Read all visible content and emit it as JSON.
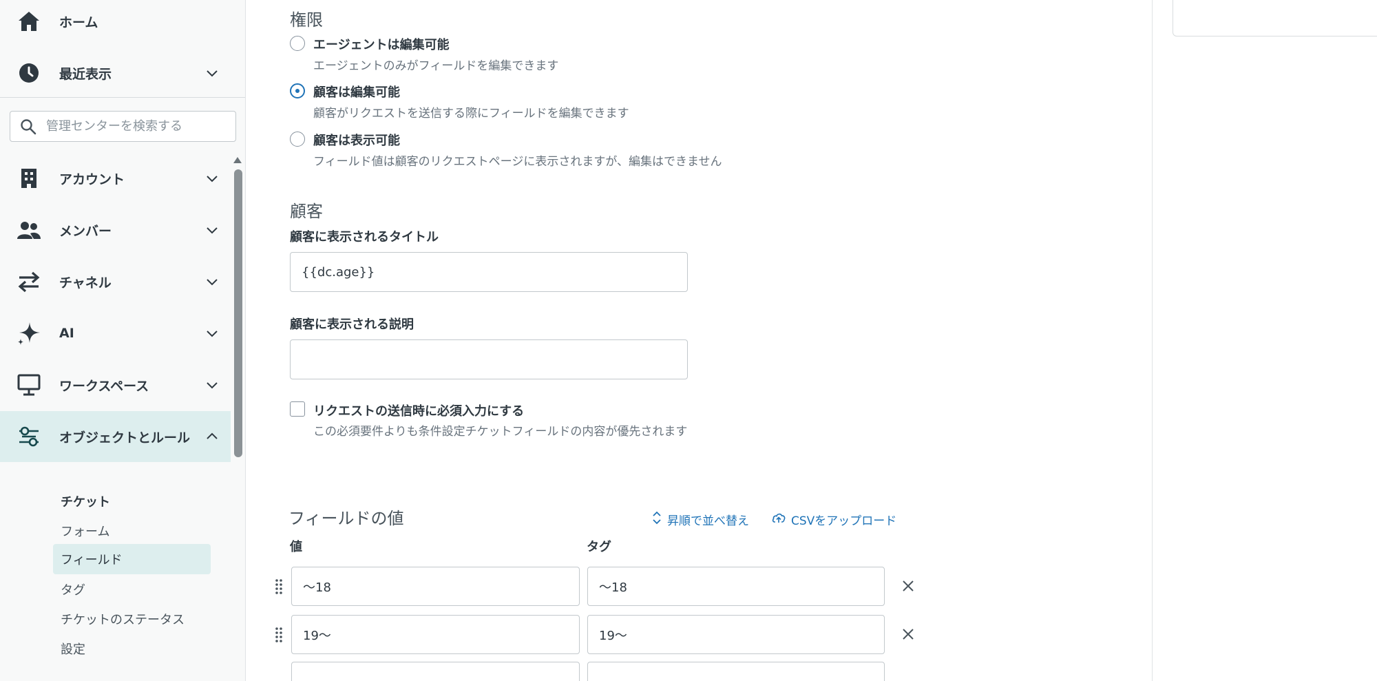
{
  "sidebar": {
    "top_items": [
      {
        "label": "ホーム",
        "icon": "home-icon"
      },
      {
        "label": "最近表示",
        "icon": "clock-icon"
      }
    ],
    "search": {
      "placeholder": "管理センターを検索する"
    },
    "items": [
      {
        "label": "アカウント",
        "icon": "building-icon"
      },
      {
        "label": "メンバー",
        "icon": "people-icon"
      },
      {
        "label": "チャネル",
        "icon": "arrows-icon"
      },
      {
        "label": "AI",
        "icon": "sparkle-icon"
      },
      {
        "label": "ワークスペース",
        "icon": "monitor-icon"
      },
      {
        "label": "オブジェクトとルール",
        "icon": "objects-rules-icon",
        "active": true
      }
    ],
    "sub_menu": {
      "header": "チケット",
      "items": [
        "フォーム",
        "フィールド",
        "タグ",
        "チケットのステータス",
        "設定"
      ],
      "selected": "フィールド"
    }
  },
  "permissions": {
    "title": "権限",
    "options": [
      {
        "label": "エージェントは編集可能",
        "hint": "エージェントのみがフィールドを編集できます",
        "checked": false
      },
      {
        "label": "顧客は編集可能",
        "hint": "顧客がリクエストを送信する際にフィールドを編集できます",
        "checked": true
      },
      {
        "label": "顧客は表示可能",
        "hint": "フィールド値は顧客のリクエストページに表示されますが、編集はできません",
        "checked": false
      }
    ]
  },
  "customer": {
    "title": "顧客",
    "title_field": {
      "label": "顧客に表示されるタイトル",
      "value": "{{dc.age}}"
    },
    "description_field": {
      "label": "顧客に表示される説明",
      "value": ""
    },
    "required": {
      "label": "リクエストの送信時に必須入力にする",
      "hint": "この必須要件よりも条件設定チケットフィールドの内容が優先されます",
      "checked": false
    }
  },
  "field_values": {
    "title": "フィールドの値",
    "sort_label": "昇順で並べ替え",
    "upload_label": "CSVをアップロード",
    "value_header": "値",
    "tag_header": "タグ",
    "rows": [
      {
        "value": "〜18",
        "tag": "〜18"
      },
      {
        "value": "19〜",
        "tag": "19〜"
      },
      {
        "value": "",
        "tag": ""
      }
    ]
  },
  "colors": {
    "accent": "#1f73b7",
    "active_bg": "#ddeeee"
  }
}
